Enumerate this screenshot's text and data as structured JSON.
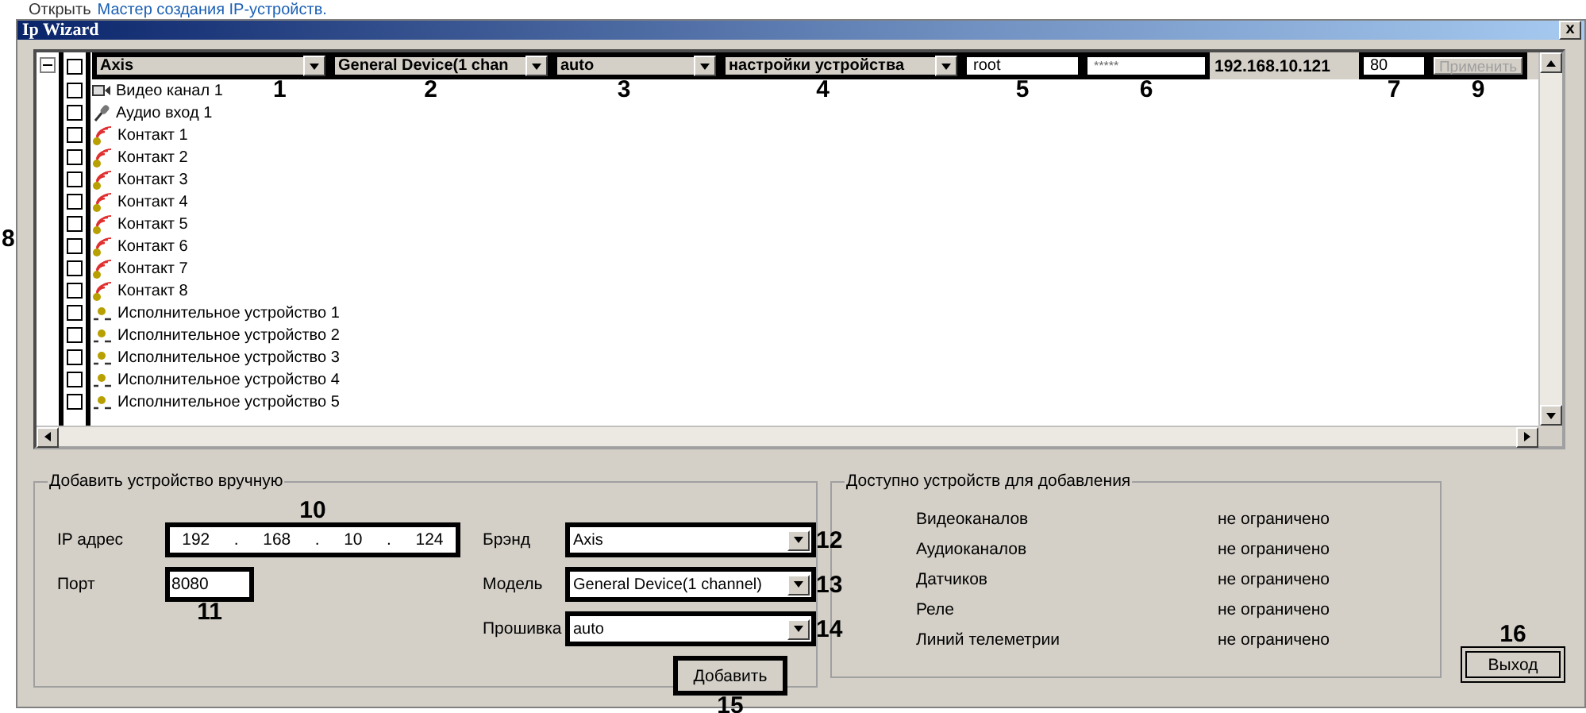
{
  "caption": {
    "prefix": "Открыть",
    "link": "Мастер создания IP-устройств."
  },
  "window": {
    "title": "Ip Wizard",
    "close": "x"
  },
  "device": {
    "expanded": true,
    "checked": false,
    "checkbox_callout": "8",
    "brand": {
      "value": "Axis",
      "callout": "1"
    },
    "model": {
      "value": "General Device(1 chan",
      "callout": "2"
    },
    "firmware": {
      "value": "auto",
      "callout": "3"
    },
    "settings": {
      "value": "настройки устройства",
      "callout": "4"
    },
    "login": {
      "value": "root",
      "callout": "5"
    },
    "password": {
      "value": "*****",
      "callout": "6"
    },
    "ip": "192.168.10.121",
    "port": {
      "value": "80",
      "callout": "7"
    },
    "apply": {
      "label": "Применить",
      "disabled": true,
      "callout": "9"
    },
    "children": [
      {
        "kind": "video",
        "label": "Видео канал 1",
        "checked": false
      },
      {
        "kind": "audio",
        "label": "Аудио вход 1",
        "checked": false
      },
      {
        "kind": "contact",
        "label": "Контакт 1",
        "checked": false
      },
      {
        "kind": "contact",
        "label": "Контакт 2",
        "checked": false
      },
      {
        "kind": "contact",
        "label": "Контакт 3",
        "checked": false
      },
      {
        "kind": "contact",
        "label": "Контакт 4",
        "checked": false
      },
      {
        "kind": "contact",
        "label": "Контакт 5",
        "checked": false
      },
      {
        "kind": "contact",
        "label": "Контакт 6",
        "checked": false
      },
      {
        "kind": "contact",
        "label": "Контакт 7",
        "checked": false
      },
      {
        "kind": "contact",
        "label": "Контакт 8",
        "checked": false
      },
      {
        "kind": "relay",
        "label": "Исполнительное устройство 1",
        "checked": false
      },
      {
        "kind": "relay",
        "label": "Исполнительное устройство 2",
        "checked": false
      },
      {
        "kind": "relay",
        "label": "Исполнительное устройство 3",
        "checked": false
      },
      {
        "kind": "relay",
        "label": "Исполнительное устройство 4",
        "checked": false
      },
      {
        "kind": "relay",
        "label": "Исполнительное устройство 5",
        "checked": false
      }
    ]
  },
  "manual": {
    "title": "Добавить устройство вручную",
    "ip": {
      "label": "IP адрес",
      "octets": [
        "192",
        "168",
        "10",
        "124"
      ],
      "separator": ".",
      "callout": "10"
    },
    "port": {
      "label": "Порт",
      "value": "8080",
      "callout": "11"
    },
    "brand": {
      "label": "Брэнд",
      "value": "Axis",
      "callout": "12"
    },
    "model": {
      "label": "Модель",
      "value": "General Device(1 channel)",
      "callout": "13"
    },
    "firmware": {
      "label": "Прошивка",
      "value": "auto",
      "callout": "14"
    },
    "add": {
      "label": "Добавить",
      "callout": "15"
    }
  },
  "available": {
    "title": "Доступно устройств для добавления",
    "rows": [
      {
        "label": "Видеоканалов",
        "value": "не ограничено"
      },
      {
        "label": "Аудиоканалов",
        "value": "не ограничено"
      },
      {
        "label": "Датчиков",
        "value": "не ограничено"
      },
      {
        "label": "Реле",
        "value": "не ограничено"
      },
      {
        "label": "Линий телеметрии",
        "value": "не ограничено"
      }
    ]
  },
  "exit": {
    "label": "Выход",
    "callout": "16"
  }
}
